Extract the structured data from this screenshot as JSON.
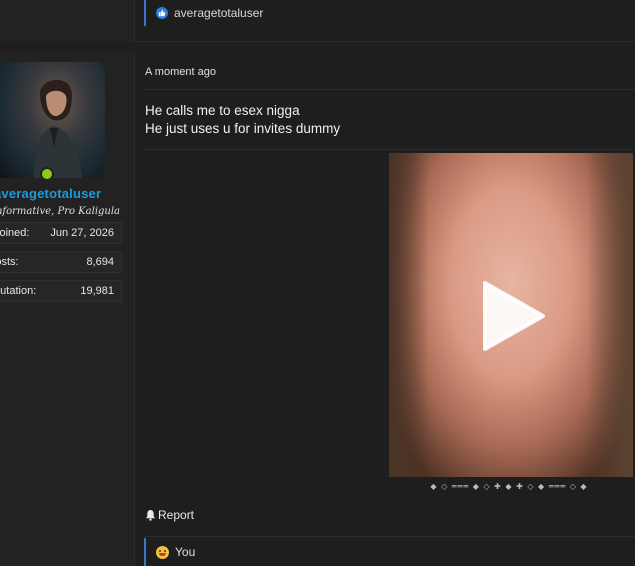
{
  "top_reaction": {
    "icon": "thumbs-up-icon",
    "user": "averagetotaluser"
  },
  "sidebar": {
    "username": "averagetotaluser",
    "usertitle": "Informative, Pro Kaligula",
    "stats": [
      {
        "label": "Joined:",
        "value": "Jun 27, 2026"
      },
      {
        "label": "Posts:",
        "value": "8,694"
      },
      {
        "label": "Reputation:",
        "value": "19,981"
      }
    ],
    "status_color": "#8cc91a",
    "username_color": "#1e9bd7"
  },
  "post": {
    "timestamp": "A moment ago",
    "lines": [
      "He calls me to esex nigga",
      "He just uses u for invites dummy"
    ],
    "media": {
      "type": "video",
      "icon": "play-icon"
    },
    "signature_divider": "◆ ◇ ═══ ◆ ◇ ✚ ◆ ✚ ◇ ◆ ═══ ◇ ◆",
    "report_label": "Report",
    "bottom_reaction": {
      "icon": "laughing-emoji-icon",
      "user": "You"
    }
  }
}
